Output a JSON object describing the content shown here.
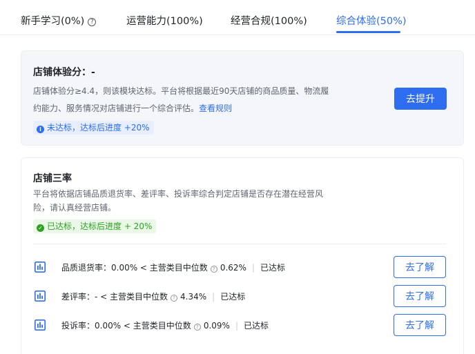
{
  "tabs": [
    {
      "label": "新手学习(0%)",
      "has_help": true
    },
    {
      "label": "运营能力(100%)"
    },
    {
      "label": "经营合规(100%)"
    },
    {
      "label": "综合体验(50%)",
      "active": true
    }
  ],
  "store_experience": {
    "title": "店铺体验分：-",
    "description": "店铺体验分≥4.4，则该模块达标。平台将根据最近90天店铺的商品质量、物流履约能力、服务情况对店铺进行一个综合评估。",
    "link_label": "查看规则",
    "status": "未达标，达标后进度 +20%",
    "button_label": "去提升"
  },
  "three_rates": {
    "title": "店铺三率",
    "description": "平台将依据店铺品质退货率、差评率、投诉率综合判定店铺是否存在潜在经营风险，请认真经营店铺。",
    "status": "已达标，达标后进度 + 20%",
    "metrics": [
      {
        "label": "品质退货率：0.00% < 主营类目中位数",
        "median": "0.62%",
        "result": "已达标",
        "button_label": "去了解"
      },
      {
        "label": "差评率：- < 主营类目中位数",
        "median": "4.34%",
        "result": "已达标",
        "button_label": "去了解"
      },
      {
        "label": "投诉率：0.00% < 主营类目中位数",
        "median": "0.09%",
        "result": "已达标",
        "button_label": "去了解"
      }
    ]
  },
  "colors": {
    "accent": "#2e6cf0",
    "success": "#2ea121",
    "text": "#1f2329",
    "muted": "#5f6670"
  },
  "icons": {
    "help": "question-circle-icon",
    "info": "info-circle-icon",
    "check": "check-circle-icon",
    "metric": "bar-chart-icon"
  }
}
